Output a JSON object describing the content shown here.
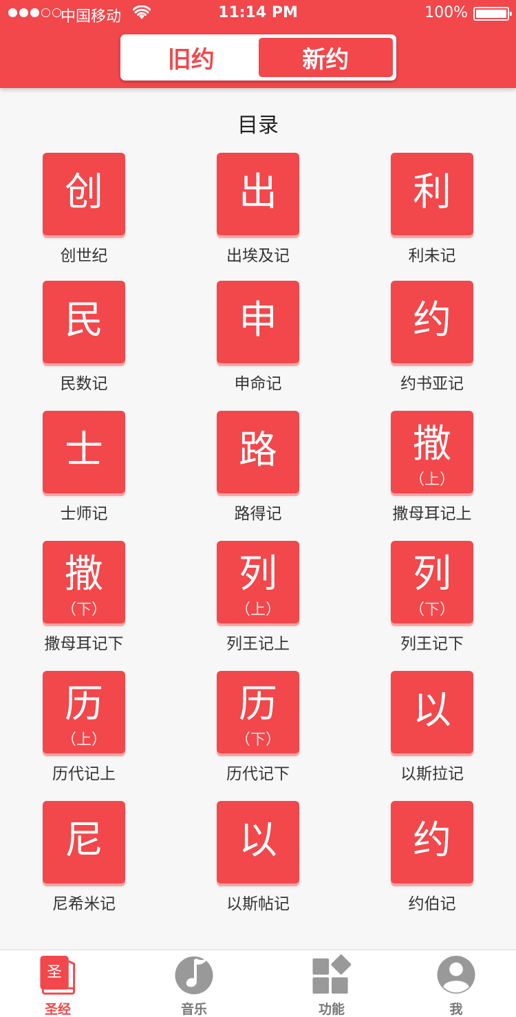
{
  "status_bar": {
    "carrier": "中国移动",
    "time": "11:14 PM",
    "battery": "100%"
  },
  "segment": {
    "old": "旧约",
    "new": "新约"
  },
  "section_title": "目录",
  "books": [
    {
      "char": "创",
      "sub": "",
      "name": "创世纪"
    },
    {
      "char": "出",
      "sub": "",
      "name": "出埃及记"
    },
    {
      "char": "利",
      "sub": "",
      "name": "利未记"
    },
    {
      "char": "民",
      "sub": "",
      "name": "民数记"
    },
    {
      "char": "申",
      "sub": "",
      "name": "申命记"
    },
    {
      "char": "约",
      "sub": "",
      "name": "约书亚记"
    },
    {
      "char": "士",
      "sub": "",
      "name": "士师记"
    },
    {
      "char": "路",
      "sub": "",
      "name": "路得记"
    },
    {
      "char": "撒",
      "sub": "（上）",
      "name": "撒母耳记上"
    },
    {
      "char": "撒",
      "sub": "（下）",
      "name": "撒母耳记下"
    },
    {
      "char": "列",
      "sub": "（上）",
      "name": "列王记上"
    },
    {
      "char": "列",
      "sub": "（下）",
      "name": "列王记下"
    },
    {
      "char": "历",
      "sub": "（上）",
      "name": "历代记上"
    },
    {
      "char": "历",
      "sub": "（下）",
      "name": "历代记下"
    },
    {
      "char": "以",
      "sub": "",
      "name": "以斯拉记"
    },
    {
      "char": "尼",
      "sub": "",
      "name": "尼希米记"
    },
    {
      "char": "以",
      "sub": "",
      "name": "以斯帖记"
    },
    {
      "char": "约",
      "sub": "",
      "name": "约伯记"
    }
  ],
  "tabbar": {
    "bible": {
      "label": "圣经",
      "icon": "bible-icon",
      "icon_text": "圣"
    },
    "music": {
      "label": "音乐",
      "icon": "music-icon"
    },
    "features": {
      "label": "功能",
      "icon": "features-icon"
    },
    "me": {
      "label": "我",
      "icon": "profile-icon"
    }
  },
  "colors": {
    "accent": "#f2474b",
    "tile_shadow": "#f7a5a5"
  }
}
